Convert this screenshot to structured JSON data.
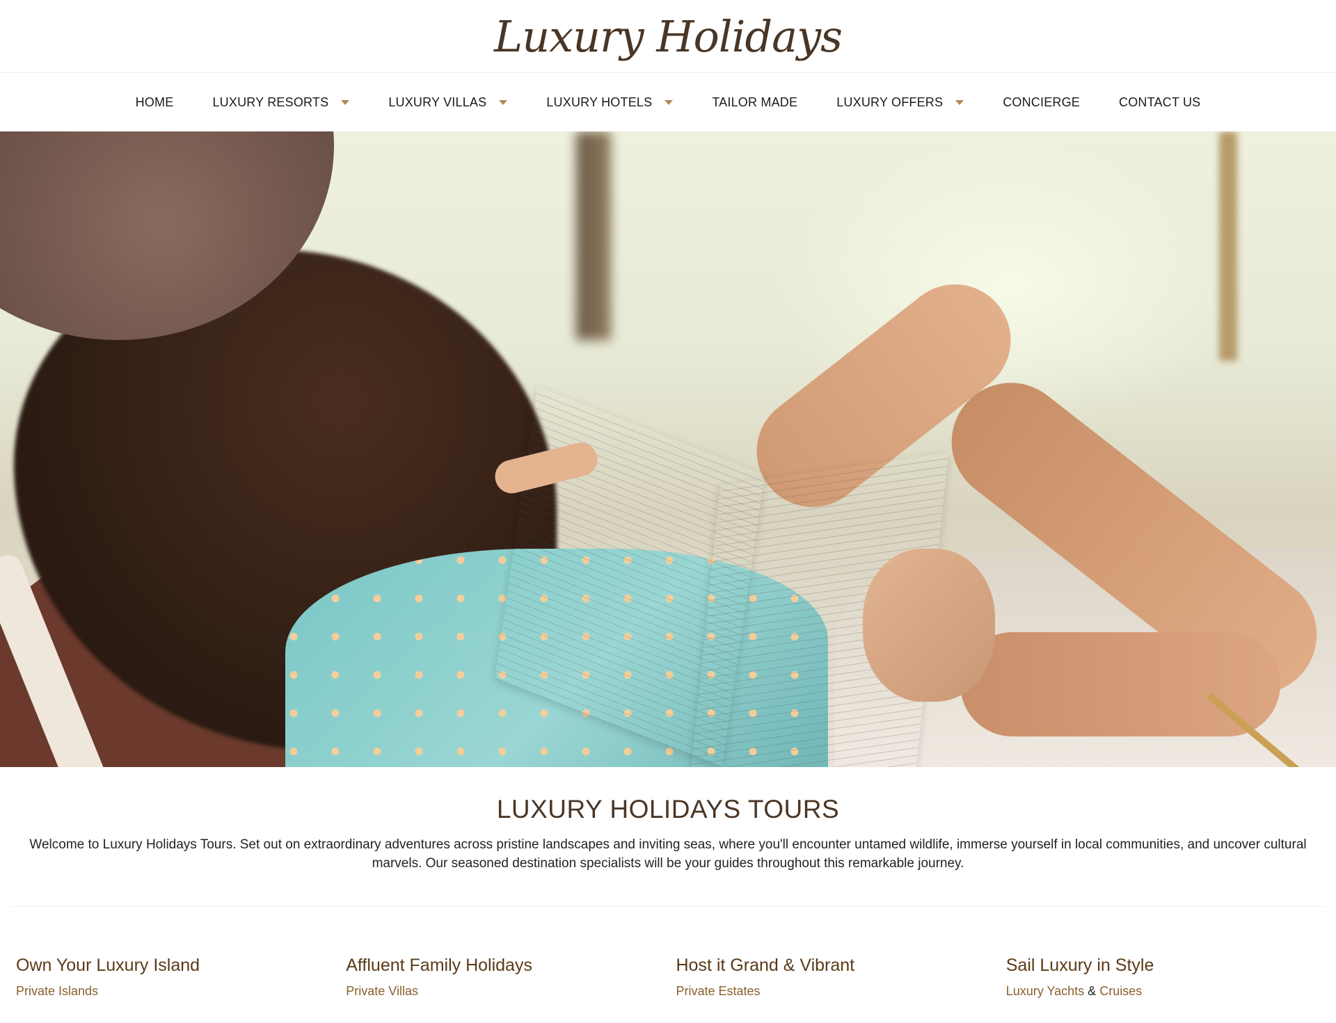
{
  "header": {
    "logo_text": "Luxury Holidays"
  },
  "nav": {
    "items": [
      {
        "label": "HOME",
        "has_dropdown": false
      },
      {
        "label": "LUXURY RESORTS",
        "has_dropdown": true
      },
      {
        "label": "LUXURY VILLAS",
        "has_dropdown": true
      },
      {
        "label": "LUXURY HOTELS",
        "has_dropdown": true
      },
      {
        "label": "TAILOR MADE",
        "has_dropdown": false
      },
      {
        "label": "LUXURY OFFERS",
        "has_dropdown": true
      },
      {
        "label": "CONCIERGE",
        "has_dropdown": false
      },
      {
        "label": "CONTACT US",
        "has_dropdown": false
      }
    ],
    "caret_icon": "caret-down-icon"
  },
  "intro": {
    "title": "LUXURY HOLIDAYS TOURS",
    "body": "Welcome to Luxury Holidays Tours. Set out on extraordinary adventures across pristine landscapes and inviting seas, where you'll encounter untamed wildlife, immerse yourself in local communities, and uncover cultural marvels. Our seasoned destination specialists will be your guides throughout this remarkable journey."
  },
  "features": [
    {
      "title": "Own Your Luxury Island",
      "subtitle": "Private Islands"
    },
    {
      "title": "Affluent Family Holidays",
      "subtitle": "Private Villas"
    },
    {
      "title": "Host it Grand & Vibrant",
      "subtitle": "Private Estates"
    },
    {
      "title": "Sail Luxury in Style",
      "subtitle_a": "Luxury Yachts",
      "subtitle_amp": "&",
      "subtitle_b": "Cruises"
    }
  ],
  "colors": {
    "brand_brown": "#4a3626",
    "accent_gold": "#b08a56",
    "link_brown": "#8a5f2b"
  }
}
